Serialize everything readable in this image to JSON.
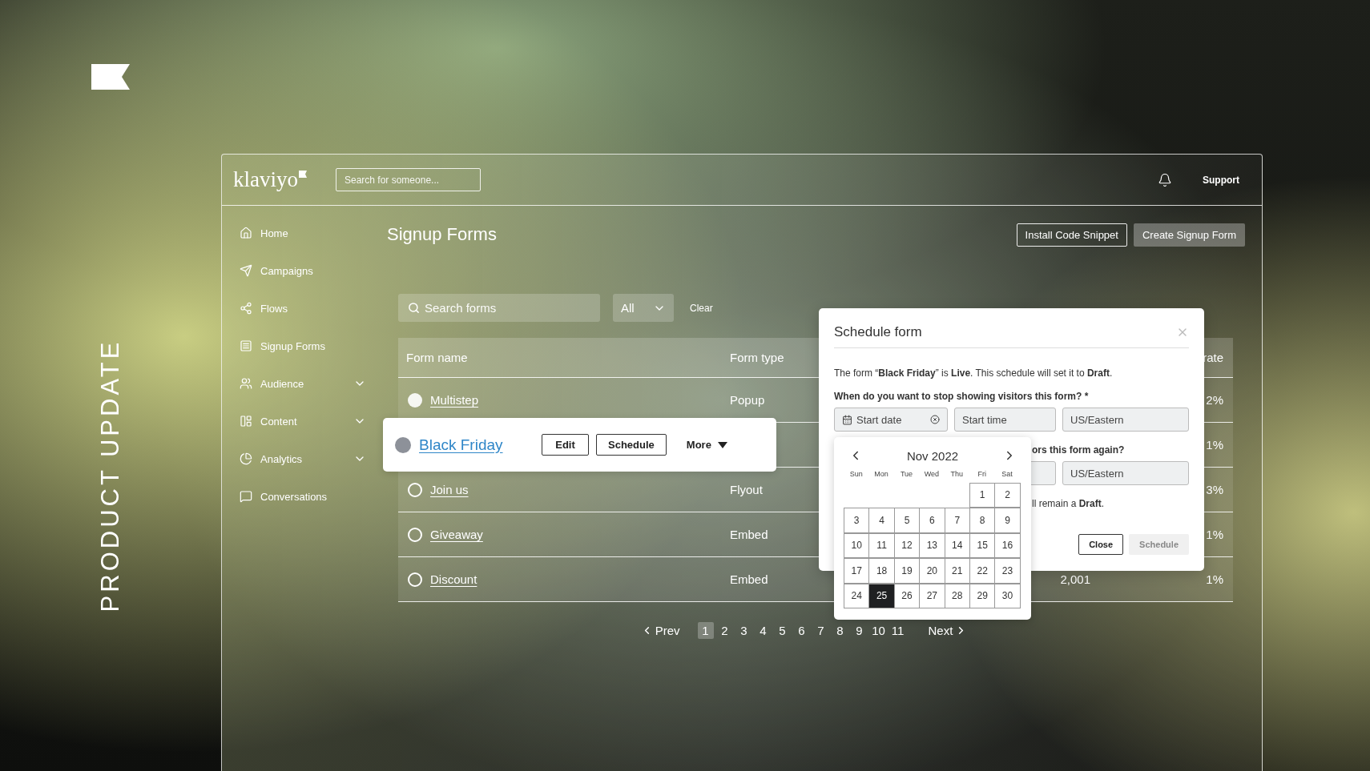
{
  "brand": {
    "tagline": "PRODUCT UPDATE"
  },
  "app": {
    "logo": "klaviyo",
    "search": {
      "placeholder": "Search for someone..."
    },
    "support": "Support"
  },
  "sidebar": {
    "items": [
      {
        "label": "Home",
        "expandable": false
      },
      {
        "label": "Campaigns",
        "expandable": false
      },
      {
        "label": "Flows",
        "expandable": false
      },
      {
        "label": "Signup Forms",
        "expandable": false
      },
      {
        "label": "Audience",
        "expandable": true
      },
      {
        "label": "Content",
        "expandable": true
      },
      {
        "label": "Analytics",
        "expandable": true
      },
      {
        "label": "Conversations",
        "expandable": false
      }
    ]
  },
  "page": {
    "title": "Signup Forms",
    "buttons": [
      {
        "label": "Install Code Snippet",
        "kind": "outline"
      },
      {
        "label": "Create Signup Form",
        "kind": "filled"
      }
    ]
  },
  "filters": {
    "search": {
      "placeholder": "Search forms"
    },
    "type_select": {
      "value": "All"
    },
    "clear": "Clear"
  },
  "table": {
    "columns": {
      "name": "Form name",
      "type": "Form type",
      "column_4": "rate"
    },
    "rows": [
      {
        "name": "Multistep",
        "filled": true,
        "type": "Popup",
        "rate": "2%",
        "highlighted": false
      },
      {
        "name": "Black Friday",
        "filled": true,
        "rate": "1%",
        "highlighted": true,
        "actions": [
          "Edit",
          "Schedule"
        ],
        "more": "More"
      },
      {
        "name": "Join us",
        "filled": false,
        "type": "Flyout",
        "rate": "3%",
        "highlighted": false
      },
      {
        "name": "Giveaway",
        "filled": false,
        "type": "Embed",
        "rate": "1%",
        "highlighted": false
      },
      {
        "name": "Discount",
        "filled": false,
        "type": "Embed",
        "column_3": "2,001",
        "rate": "1%",
        "highlighted": false
      }
    ]
  },
  "pagination": {
    "prev": "Prev",
    "next": "Next",
    "pages": [
      {
        "label": "1",
        "selected": true
      },
      {
        "label": "2",
        "selected": false
      },
      {
        "label": "3",
        "selected": false
      },
      {
        "label": "4",
        "selected": false
      },
      {
        "label": "5",
        "selected": false
      },
      {
        "label": "6",
        "selected": false
      },
      {
        "label": "7",
        "selected": false
      },
      {
        "label": "8",
        "selected": false
      },
      {
        "label": "9",
        "selected": false
      },
      {
        "label": "10",
        "selected": false
      },
      {
        "label": "11",
        "selected": false
      }
    ]
  },
  "dialog": {
    "title": "Schedule form",
    "intro": "The form “**Black Friday**” is **Live**. This schedule will set it to **Draft**.",
    "stop_question": "When do you want to stop showing visitors this form? *",
    "stop_fields": {
      "date_placeholder": "Start date",
      "time_placeholder": "Start time",
      "timezone": "US/Eastern"
    },
    "restart_question": "ors this form again?",
    "restart_timezone": "US/Eastern",
    "note": "ll remain a **Draft**.",
    "buttons": [
      {
        "label": "Close",
        "kind": "outline"
      },
      {
        "label": "Schedule",
        "kind": "disabled"
      }
    ]
  },
  "calendar": {
    "month": "Nov 2022",
    "weekdays": [
      "Sun",
      "Mon",
      "Tue",
      "Wed",
      "Thu",
      "Fri",
      "Sat"
    ],
    "weeks": [
      [
        {
          "label": "1",
          "selected": false
        },
        {
          "label": "2",
          "selected": false
        }
      ],
      [
        {
          "label": "3",
          "selected": false
        },
        {
          "label": "4",
          "selected": false
        },
        {
          "label": "5",
          "selected": false
        },
        {
          "label": "6",
          "selected": false
        },
        {
          "label": "7",
          "selected": false
        },
        {
          "label": "8",
          "selected": false
        },
        {
          "label": "9",
          "selected": false
        }
      ],
      [
        {
          "label": "10",
          "selected": false
        },
        {
          "label": "11",
          "selected": false
        },
        {
          "label": "12",
          "selected": false
        },
        {
          "label": "13",
          "selected": false
        },
        {
          "label": "14",
          "selected": false
        },
        {
          "label": "15",
          "selected": false
        },
        {
          "label": "16",
          "selected": false
        }
      ],
      [
        {
          "label": "17",
          "selected": false
        },
        {
          "label": "18",
          "selected": false
        },
        {
          "label": "19",
          "selected": false
        },
        {
          "label": "20",
          "selected": false
        },
        {
          "label": "21",
          "selected": false
        },
        {
          "label": "22",
          "selected": false
        },
        {
          "label": "23",
          "selected": false
        }
      ],
      [
        {
          "label": "24",
          "selected": false
        },
        {
          "label": "25",
          "selected": true
        },
        {
          "label": "26",
          "selected": false
        },
        {
          "label": "27",
          "selected": false
        },
        {
          "label": "28",
          "selected": false
        },
        {
          "label": "29",
          "selected": false
        },
        {
          "label": "30",
          "selected": false
        }
      ]
    ]
  }
}
